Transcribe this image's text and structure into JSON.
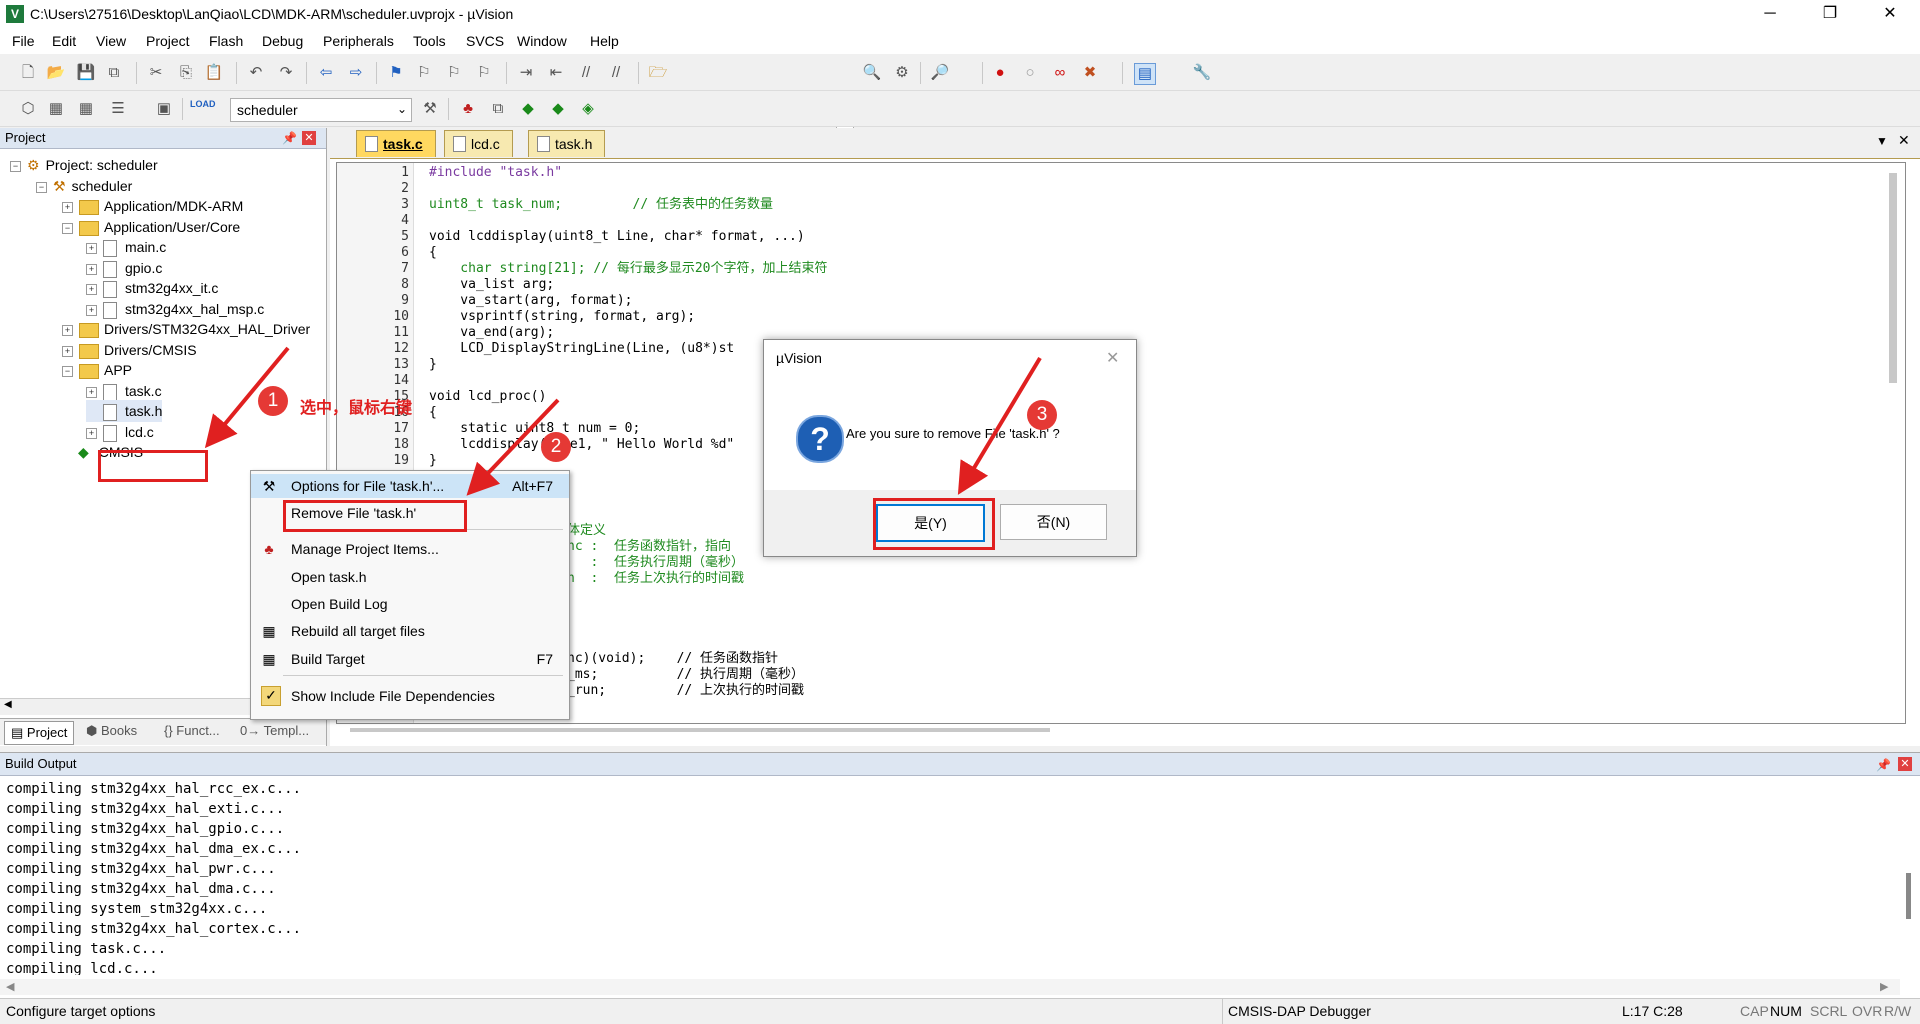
{
  "window": {
    "title": "C:\\Users\\27516\\Desktop\\LanQiao\\LCD\\MDK-ARM\\scheduler.uvprojx - µVision",
    "minimize": "─",
    "maximize": "❐",
    "close": "✕"
  },
  "menu": [
    "File",
    "Edit",
    "View",
    "Project",
    "Flash",
    "Debug",
    "Peripherals",
    "Tools",
    "SVCS",
    "Window",
    "Help"
  ],
  "toolbar2": {
    "target_select": "scheduler",
    "load_label": "LOAD"
  },
  "project_panel": {
    "title": "Project",
    "tree": [
      {
        "label": "Project: scheduler"
      },
      {
        "label": "scheduler"
      },
      {
        "label": "Application/MDK-ARM"
      },
      {
        "label": "Application/User/Core"
      },
      {
        "label": "main.c"
      },
      {
        "label": "gpio.c"
      },
      {
        "label": "stm32g4xx_it.c"
      },
      {
        "label": "stm32g4xx_hal_msp.c"
      },
      {
        "label": "Drivers/STM32G4xx_HAL_Driver"
      },
      {
        "label": "Drivers/CMSIS"
      },
      {
        "label": "APP"
      },
      {
        "label": "task.c"
      },
      {
        "label": "task.h"
      },
      {
        "label": "lcd.c"
      },
      {
        "label": "CMSIS"
      }
    ],
    "bottom_tabs": [
      "Project",
      "Books",
      "{} Funct...",
      "0→ Templ..."
    ]
  },
  "editor": {
    "tabs": [
      "task.c",
      "lcd.c",
      "task.h"
    ],
    "line_numbers": [
      "1",
      "2",
      "3",
      "4",
      "5",
      "6",
      "7",
      "8",
      "9",
      "10",
      "11",
      "12",
      "13",
      "14",
      "15",
      "16",
      "17",
      "18",
      "19"
    ],
    "code": [
      "#include \"task.h\"",
      "",
      "uint8_t task_num;         // 任务表中的任务数量",
      "",
      "void lcddisplay(uint8_t Line, char* format, ...)",
      "{",
      "    char string[21]; // 每行最多显示20个字符，加上结束符",
      "    va_list arg;",
      "    va_start(arg, format);",
      "    vsprintf(string, format, arg);",
      "    va_end(arg);",
      "    LCD_DisplayStringLine(Line, (u8*)st",
      "}",
      "",
      "void lcd_proc()",
      "{",
      "    static uint8_t num = 0;",
      "    lcddisplay(Line1, \" Hello World %d\"",
      "}"
    ],
    "code_fragments": [
      "体定义",
      "nc :  任务函数指针，指向",
      "   :  任务执行周期（毫秒）",
      "n  :  任务上次执行的时间戳",
      "nc)(void);    // 任务函数指针",
      "_ms;          // 执行周期（毫秒）",
      "_run;         // 上次执行的时间戳"
    ]
  },
  "context_menu": {
    "items": [
      {
        "label": "Options for File 'task.h'...",
        "shortcut": "Alt+F7"
      },
      {
        "label": "Remove File 'task.h'",
        "shortcut": ""
      },
      {
        "label": "Manage Project Items...",
        "shortcut": ""
      },
      {
        "label": "Open task.h",
        "shortcut": ""
      },
      {
        "label": "Open Build Log",
        "shortcut": ""
      },
      {
        "label": "Rebuild all target files",
        "shortcut": ""
      },
      {
        "label": "Build Target",
        "shortcut": "F7"
      },
      {
        "label": "Show Include File Dependencies",
        "shortcut": ""
      }
    ]
  },
  "dialog": {
    "title": "µVision",
    "message": "Are you sure to remove File 'task.h' ?",
    "yes_label": "是(Y)",
    "no_label": "否(N)"
  },
  "annotations": {
    "step1_number": "1",
    "step1_text": "选中，鼠标右键",
    "step2_number": "2",
    "step3_number": "3"
  },
  "build_output": {
    "title": "Build Output",
    "lines": [
      "compiling stm32g4xx_hal_rcc_ex.c...",
      "compiling stm32g4xx_hal_exti.c...",
      "compiling stm32g4xx_hal_gpio.c...",
      "compiling stm32g4xx_hal_dma_ex.c...",
      "compiling stm32g4xx_hal_pwr.c...",
      "compiling stm32g4xx_hal_dma.c...",
      "compiling system_stm32g4xx.c...",
      "compiling stm32g4xx_hal_cortex.c...",
      "compiling task.c...",
      "compiling lcd.c..."
    ]
  },
  "status": {
    "left": "Configure target options",
    "debugger": "CMSIS-DAP Debugger",
    "position": "L:17 C:28",
    "cap": "CAP",
    "num": "NUM",
    "scrl": "SCRL",
    "ovr": "OVR",
    "rw": "R/W"
  },
  "colors": {
    "annotation": "#e02020",
    "panel_header": "#dde6f2",
    "tab_active": "#f7e9b0",
    "code_comment": "#1f8a1f",
    "code_keyword": "#0000c8",
    "code_string": "#b020b0"
  }
}
